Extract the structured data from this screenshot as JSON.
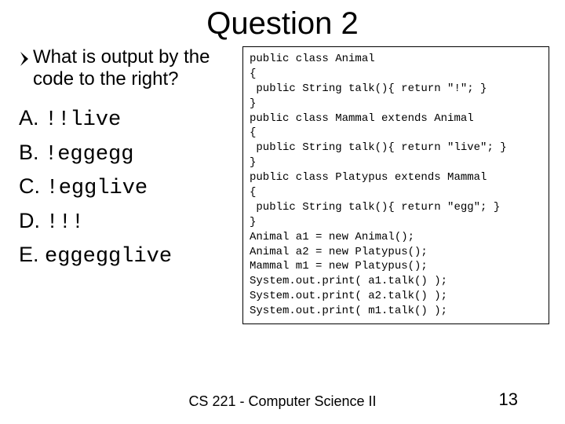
{
  "title": "Question 2",
  "question": "What is output by the code to the right?",
  "options": [
    {
      "letter": "A.",
      "code": "!!live"
    },
    {
      "letter": "B.",
      "code": "!eggegg"
    },
    {
      "letter": "C.",
      "code": "!egglive"
    },
    {
      "letter": "D.",
      "code": "!!!"
    },
    {
      "letter": "E.",
      "code": "eggegglive"
    }
  ],
  "code": "public class Animal\n{\n public String talk(){ return \"!\"; }\n}\npublic class Mammal extends Animal\n{\n public String talk(){ return \"live\"; }\n}\npublic class Platypus extends Mammal\n{\n public String talk(){ return \"egg\"; }\n}\nAnimal a1 = new Animal();\nAnimal a2 = new Platypus();\nMammal m1 = new Platypus();\nSystem.out.print( a1.talk() );\nSystem.out.print( a2.talk() );\nSystem.out.print( m1.talk() );",
  "footer": "CS 221 - Computer Science II",
  "page_number": "13"
}
